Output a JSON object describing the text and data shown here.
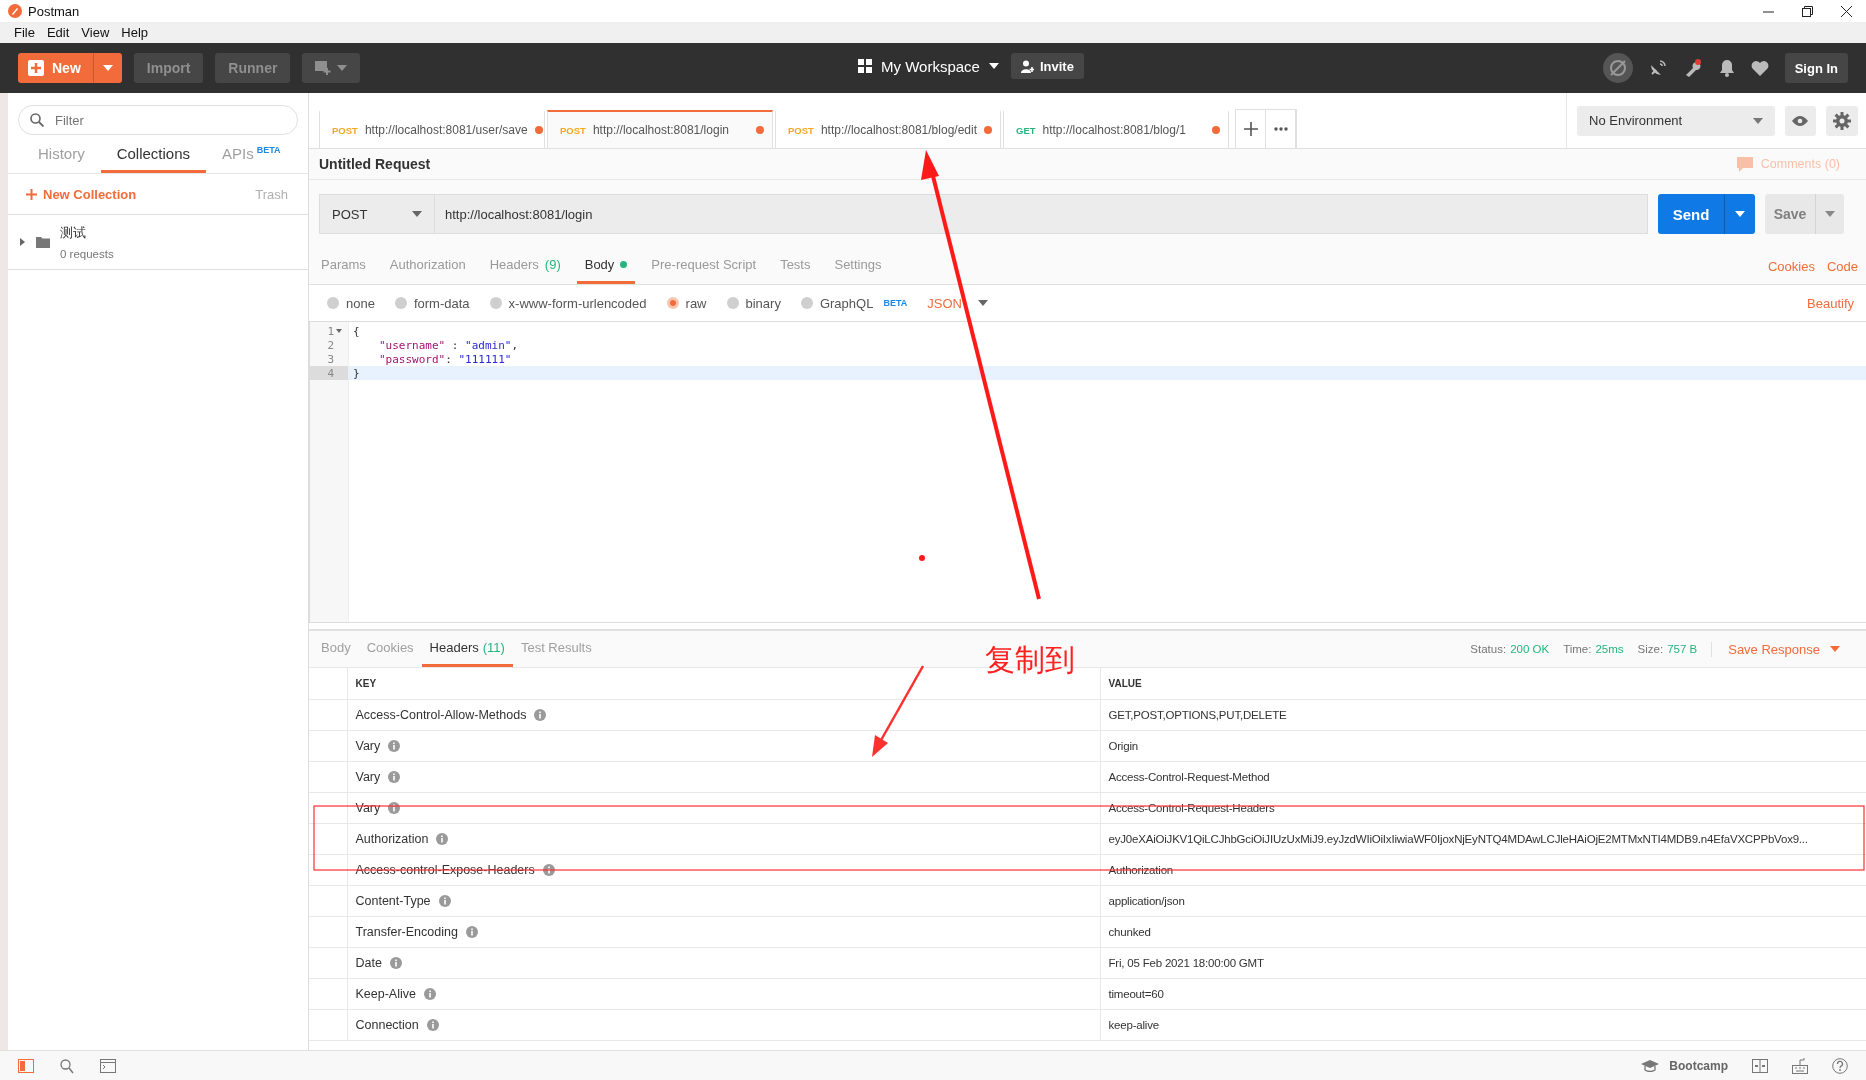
{
  "window": {
    "title": "Postman"
  },
  "menu": [
    "File",
    "Edit",
    "View",
    "Help"
  ],
  "header": {
    "new_button": "New",
    "import_button": "Import",
    "runner_button": "Runner",
    "workspace": "My Workspace",
    "invite_button": "Invite",
    "sign_in_button": "Sign In"
  },
  "sidebar": {
    "search": {
      "placeholder": "Filter"
    },
    "tabs": [
      {
        "label": "History",
        "selected": false
      },
      {
        "label": "Collections",
        "selected": true
      },
      {
        "label": "APIs",
        "badge": "BETA",
        "selected": false
      }
    ],
    "new_collection": "New Collection",
    "trash": "Trash",
    "collections": [
      {
        "name": "测试",
        "meta": "0 requests",
        "expanded": false
      }
    ]
  },
  "request_tabs": [
    {
      "method": "POST",
      "color": "#f5a623",
      "url": "http://localhost:8081/user/save",
      "unsaved": true,
      "selected": false
    },
    {
      "method": "POST",
      "color": "#f5a623",
      "url": "http://localhost:8081/login",
      "unsaved": true,
      "selected": true
    },
    {
      "method": "POST",
      "color": "#f5a623",
      "url": "http://localhost:8081/blog/edit",
      "unsaved": true,
      "selected": false
    },
    {
      "method": "GET",
      "color": "#26b47f",
      "url": "http://localhost:8081/blog/1",
      "unsaved": true,
      "selected": false
    }
  ],
  "environment": "No Environment",
  "request": {
    "title": "Untitled Request",
    "comments": "Comments (0)",
    "method": "POST",
    "url": "http://localhost:8081/login",
    "send": "Send",
    "save": "Save"
  },
  "request_sections": [
    {
      "label": "Params",
      "selected": false,
      "modified": false
    },
    {
      "label": "Authorization",
      "selected": false,
      "modified": false
    },
    {
      "label": "Headers",
      "count": "(9)",
      "selected": false,
      "modified": false
    },
    {
      "label": "Body",
      "selected": true,
      "modified": true
    },
    {
      "label": "Pre-request Script",
      "selected": false,
      "modified": false
    },
    {
      "label": "Tests",
      "selected": false,
      "modified": false
    },
    {
      "label": "Settings",
      "selected": false,
      "modified": false
    }
  ],
  "cookies_link": "Cookies",
  "code_link": "Code",
  "body_types": [
    {
      "label": "none",
      "selected": false
    },
    {
      "label": "form-data",
      "selected": false
    },
    {
      "label": "x-www-form-urlencoded",
      "selected": false
    },
    {
      "label": "raw",
      "selected": true
    },
    {
      "label": "binary",
      "selected": false
    },
    {
      "label": "GraphQL",
      "badge": "BETA",
      "selected": false
    }
  ],
  "format": "JSON",
  "beautify": "Beautify",
  "editor": {
    "lines": [
      {
        "number": "1",
        "active": false,
        "indented": false,
        "tokens": [
          {
            "kind": "plain",
            "text": "{"
          }
        ]
      },
      {
        "number": "2",
        "active": false,
        "indented": true,
        "tokens": [
          {
            "kind": "key",
            "text": "\"username\""
          },
          {
            "kind": "plain",
            "text": " : "
          },
          {
            "kind": "string",
            "text": "\"admin\""
          },
          {
            "kind": "plain",
            "text": ","
          }
        ]
      },
      {
        "number": "3",
        "active": false,
        "indented": true,
        "tokens": [
          {
            "kind": "key",
            "text": "\"password\""
          },
          {
            "kind": "plain",
            "text": ": "
          },
          {
            "kind": "string",
            "text": "\"111111\""
          }
        ]
      },
      {
        "number": "4",
        "active": true,
        "indented": false,
        "tokens": [
          {
            "kind": "plain",
            "text": "}"
          }
        ]
      }
    ]
  },
  "response": {
    "tabs": [
      {
        "label": "Body",
        "selected": false
      },
      {
        "label": "Cookies",
        "selected": false
      },
      {
        "label": "Headers",
        "count": "(11)",
        "selected": true
      },
      {
        "label": "Test Results",
        "selected": false
      }
    ],
    "status_label": "Status:",
    "status": "200 OK",
    "time_label": "Time:",
    "time": "25ms",
    "size_label": "Size:",
    "size": "757 B",
    "save_response": "Save Response",
    "columns": [
      "KEY",
      "VALUE"
    ],
    "rows": [
      {
        "key": "Access-Control-Allow-Methods",
        "value": "GET,POST,OPTIONS,PUT,DELETE"
      },
      {
        "key": "Vary",
        "value": "Origin"
      },
      {
        "key": "Vary",
        "value": "Access-Control-Request-Method"
      },
      {
        "key": "Vary",
        "value": "Access-Control-Request-Headers"
      },
      {
        "key": "Authorization",
        "value": "eyJ0eXAiOiJKV1QiLCJhbGciOiJIUzUxMiJ9.eyJzdWIiOiIxIiwiaWF0IjoxNjEyNTQ4MDAwLCJleHAiOjE2MTMxNTI4MDB9.n4EfaVXCPPbVox9..."
      },
      {
        "key": "Access-control-Expose-Headers",
        "value": "Authorization"
      },
      {
        "key": "Content-Type",
        "value": "application/json"
      },
      {
        "key": "Transfer-Encoding",
        "value": "chunked"
      },
      {
        "key": "Date",
        "value": "Fri, 05 Feb 2021 18:00:00 GMT"
      },
      {
        "key": "Keep-Alive",
        "value": "timeout=60"
      },
      {
        "key": "Connection",
        "value": "keep-alive"
      }
    ]
  },
  "footer": {
    "bootcamp": "Bootcamp"
  },
  "annotation": {
    "text": "复制到"
  }
}
